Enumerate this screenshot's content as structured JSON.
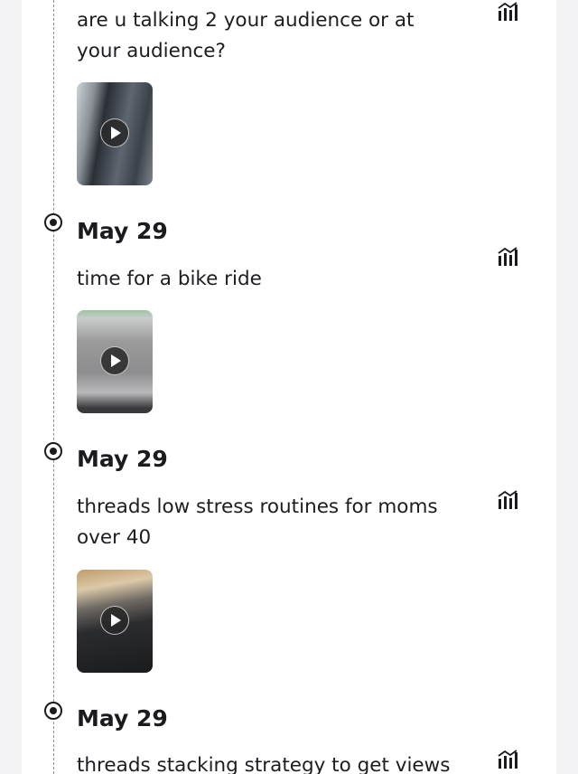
{
  "entries": [
    {
      "date": "",
      "text": "are u talking 2 your audience or at your audience?",
      "stats_icon": "chart-stats-icon",
      "thumbnail_icon": "play-icon"
    },
    {
      "date": "May 29",
      "text": "time for a bike ride",
      "stats_icon": "chart-stats-icon",
      "thumbnail_icon": "play-icon"
    },
    {
      "date": "May 29",
      "text": "threads low stress routines for moms over 40",
      "stats_icon": "chart-stats-icon",
      "thumbnail_icon": "play-icon"
    },
    {
      "date": "May 29",
      "text": "threads stacking strategy to get views",
      "stats_icon": "chart-stats-icon"
    }
  ],
  "colors": {
    "timeline": "#8c8c92",
    "text": "#1b1b1f",
    "background": "#f3f3f5",
    "card": "#ffffff"
  }
}
